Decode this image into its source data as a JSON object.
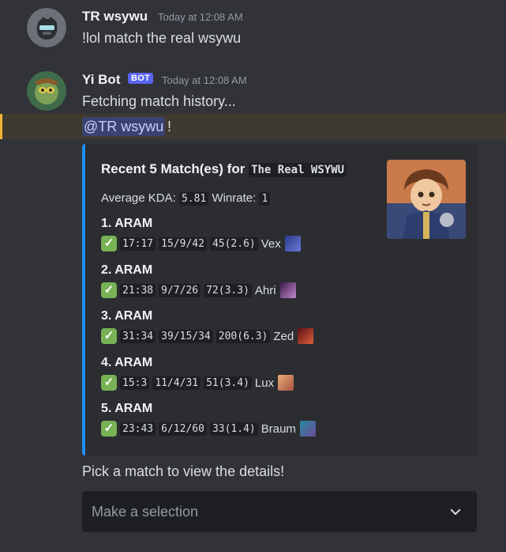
{
  "message1": {
    "username": "TR wsywu",
    "timestamp": "Today at 12:08 AM",
    "text": "!lol match the real wsywu"
  },
  "message2": {
    "username": "Yi Bot",
    "badge": "BOT",
    "timestamp": "Today at 12:08 AM",
    "text": "Fetching match history...",
    "mention": "@TR wsywu",
    "mention_tail": "!"
  },
  "embed": {
    "title_prefix": "Recent 5 Match(es) for",
    "title_player": "The Real WSYWU",
    "avg_kda_label": "Average KDA:",
    "avg_kda": "5.81",
    "winrate_label": "Winrate:",
    "winrate": "1",
    "accent_color": "#1e90ff",
    "matches": [
      {
        "title": "1. ARAM",
        "duration": "17:17",
        "kda": "15/9/42",
        "cs": "45(2.6)",
        "champion": "Vex",
        "result_icon": "check-icon"
      },
      {
        "title": "2. ARAM",
        "duration": "21:38",
        "kda": "9/7/26",
        "cs": "72(3.3)",
        "champion": "Ahri",
        "result_icon": "check-icon"
      },
      {
        "title": "3. ARAM",
        "duration": "31:34",
        "kda": "39/15/34",
        "cs": "200(6.3)",
        "champion": "Zed",
        "result_icon": "check-icon"
      },
      {
        "title": "4. ARAM",
        "duration": "15:3",
        "kda": "11/4/31",
        "cs": "51(3.4)",
        "champion": "Lux",
        "result_icon": "check-icon"
      },
      {
        "title": "5. ARAM",
        "duration": "23:43",
        "kda": "6/12/60",
        "cs": "33(1.4)",
        "champion": "Braum",
        "result_icon": "check-icon"
      }
    ]
  },
  "footer_text": "Pick a match to view the details!",
  "select": {
    "placeholder": "Make a selection"
  }
}
